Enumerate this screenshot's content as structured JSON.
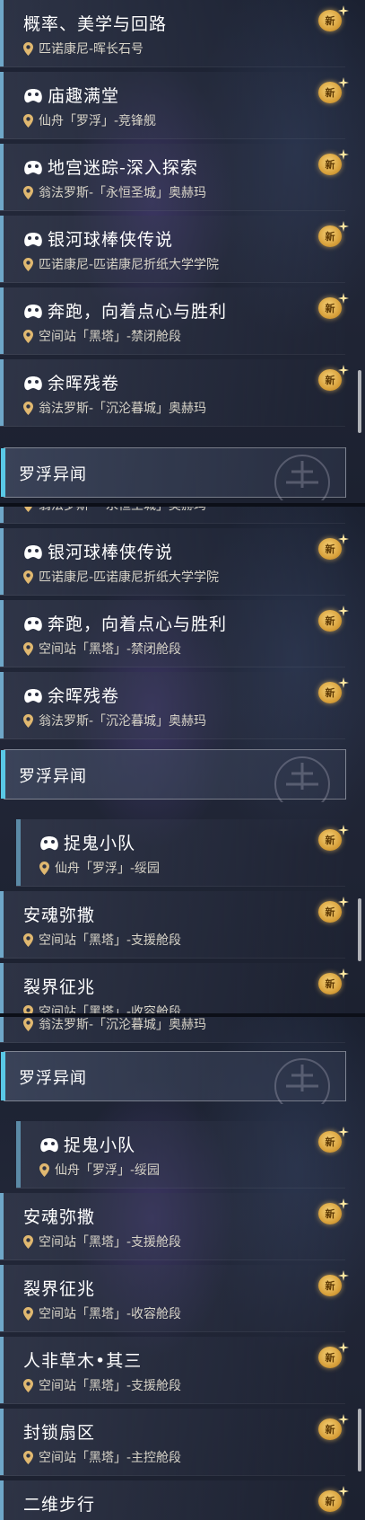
{
  "icons": {
    "quest": "quest-gamepad-icon",
    "location": "location-pin-icon",
    "new": "new-badge-icon",
    "section_emblem": "xianzhou-emblem-icon"
  },
  "colors": {
    "accent_cyan": "#59c8e6",
    "badge_gold": "#d9a23c",
    "row_bar": "#6fa7c8"
  },
  "new_label": "新",
  "panel1": {
    "rows": [
      {
        "title": "概率、美学与回路",
        "location": "匹诺康尼-晖长石号",
        "has_icon": false
      },
      {
        "title": "庙趣满堂",
        "location": "仙舟「罗浮」-竞锋舰",
        "has_icon": true
      },
      {
        "title": "地宫迷踪-深入探索",
        "location": "翁法罗斯-「永恒圣城」奥赫玛",
        "has_icon": true
      },
      {
        "title": "银河球棒侠传说",
        "location": "匹诺康尼-匹诺康尼折纸大学学院",
        "has_icon": true
      },
      {
        "title": "奔跑，向着点心与胜利",
        "location": "空间站「黑塔」-禁闭舱段",
        "has_icon": true
      },
      {
        "title": "余晖残卷",
        "location": "翁法罗斯-「沉沦暮城」奥赫玛",
        "has_icon": true
      }
    ],
    "section": "罗浮异闻"
  },
  "panel2": {
    "partial_top": "翁法罗斯-「永恒圣城」奥赫玛",
    "rows": [
      {
        "title": "银河球棒侠传说",
        "location": "匹诺康尼-匹诺康尼折纸大学学院",
        "has_icon": true
      },
      {
        "title": "奔跑，向着点心与胜利",
        "location": "空间站「黑塔」-禁闭舱段",
        "has_icon": true
      },
      {
        "title": "余晖残卷",
        "location": "翁法罗斯-「沉沦暮城」奥赫玛",
        "has_icon": true
      }
    ],
    "section": "罗浮异闻",
    "sub_row": {
      "title": "捉鬼小队",
      "location": "仙舟「罗浮」-绥园",
      "has_icon": true
    },
    "rows_after": [
      {
        "title": "安魂弥撒",
        "location": "空间站「黑塔」-支援舱段",
        "has_icon": false
      },
      {
        "title": "裂界征兆",
        "location": "空间站「黑塔」-收容舱段",
        "has_icon": false
      }
    ]
  },
  "panel3": {
    "partial_top": "翁法罗斯-「沉沦暮城」奥赫玛",
    "section": "罗浮异闻",
    "sub_row": {
      "title": "捉鬼小队",
      "location": "仙舟「罗浮」-绥园",
      "has_icon": true
    },
    "rows": [
      {
        "title": "安魂弥撒",
        "location": "空间站「黑塔」-支援舱段",
        "has_icon": false
      },
      {
        "title": "裂界征兆",
        "location": "空间站「黑塔」-收容舱段",
        "has_icon": false
      },
      {
        "title": "人非草木•其三",
        "location": "空间站「黑塔」-支援舱段",
        "has_icon": false
      },
      {
        "title": "封锁扇区",
        "location": "空间站「黑塔」-主控舱段",
        "has_icon": false
      },
      {
        "title": "二维步行",
        "location": "",
        "has_icon": false
      }
    ]
  }
}
